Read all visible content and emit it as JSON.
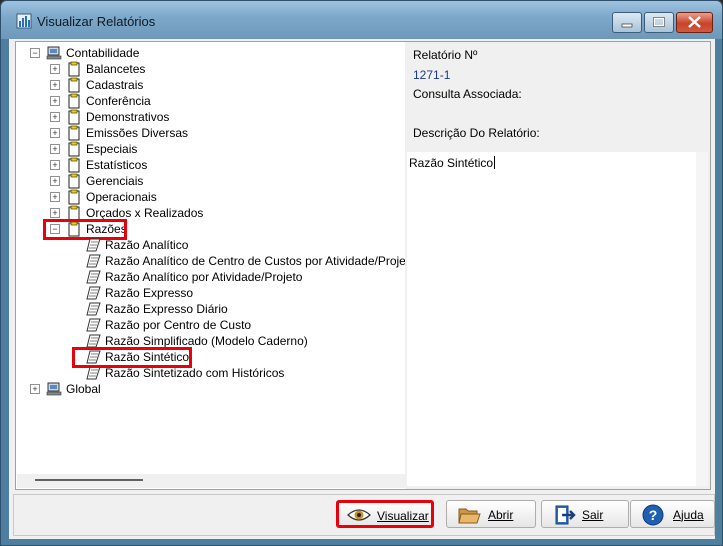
{
  "window": {
    "title": "Visualizar Relatórios"
  },
  "tree": {
    "root1": "Contabilidade",
    "folders": [
      "Balancetes",
      "Cadastrais",
      "Conferência",
      "Demonstrativos",
      "Emissões Diversas",
      "Especiais",
      "Estatísticos",
      "Gerenciais",
      "Operacionais",
      "Orçados x Realizados"
    ],
    "expanded_folder": "Razões",
    "reports": [
      "Razão Analítico",
      "Razão Analítico de Centro de Custos por Atividade/Projet",
      "Razão Analítico por Atividade/Projeto",
      "Razão Expresso",
      "Razão Expresso Diário",
      "Razão por Centro de Custo",
      "Razão Simplificado (Modelo Caderno)",
      "Razão Sintético",
      "Razão Sintetizado com Históricos"
    ],
    "selected_report": "Razão Sintético",
    "root2": "Global"
  },
  "info": {
    "report_no_label": "Relatório Nº",
    "report_no": "1271-1",
    "query_label": "Consulta Associada:",
    "description_label": "Descrição Do Relatório:",
    "description": "Razão Sintético"
  },
  "buttons": {
    "visualizar": "Visualizar",
    "abrir": "Abrir",
    "sair": "Sair",
    "ajuda": "Ajuda"
  },
  "colors": {
    "highlight": "#e8000b",
    "link": "#1a3a8a"
  }
}
